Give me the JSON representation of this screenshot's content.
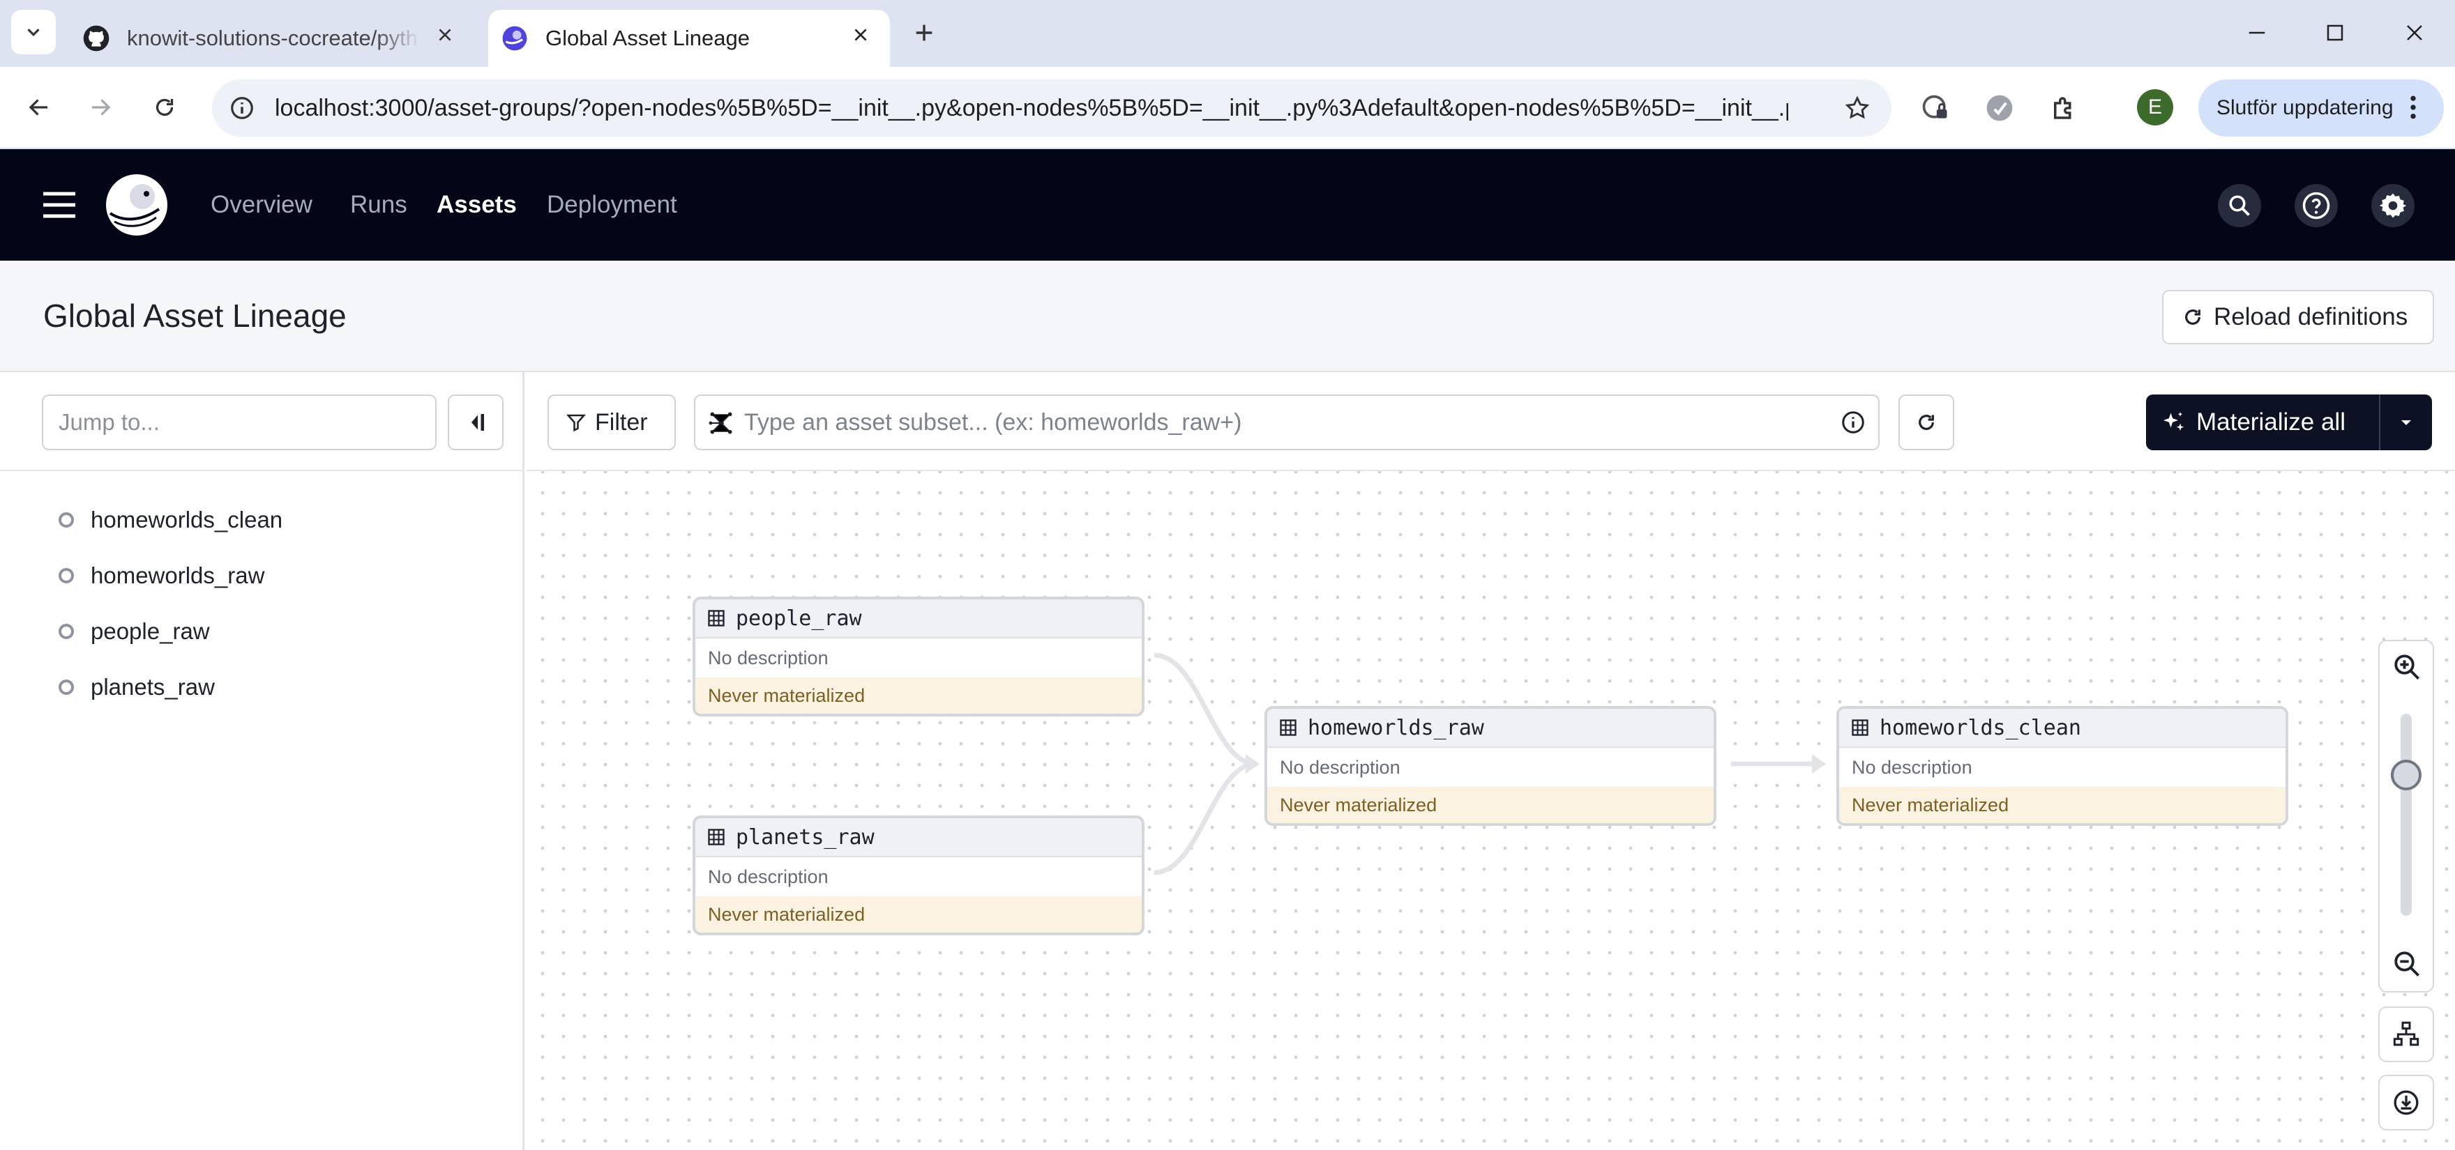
{
  "browser": {
    "tabs": [
      {
        "title": "knowit-solutions-cocreate/pyth",
        "favicon": "github-icon",
        "active": false
      },
      {
        "title": "Global Asset Lineage",
        "favicon": "dagster-icon",
        "active": true
      }
    ],
    "url": "localhost:3000/asset-groups/?open-nodes%5B%5D=__init__.py&open-nodes%5B%5D=__init__.py%3Adefault&open-nodes%5B%5D=__init__.p...",
    "profile_initial": "E",
    "update_label": "Slutför uppdatering"
  },
  "app": {
    "nav": [
      "Overview",
      "Runs",
      "Assets",
      "Deployment"
    ],
    "active_nav": "Assets",
    "page_title": "Global Asset Lineage",
    "reload_label": "Reload definitions"
  },
  "sidebar": {
    "jump_placeholder": "Jump to...",
    "assets": [
      "homeworlds_clean",
      "homeworlds_raw",
      "people_raw",
      "planets_raw"
    ]
  },
  "toolbar": {
    "filter_label": "Filter",
    "subset_placeholder": "Type an asset subset... (ex: homeworlds_raw+)",
    "materialize_label": "Materialize all"
  },
  "graph": {
    "nodes": [
      {
        "name": "people_raw",
        "description": "No description",
        "status": "Never materialized"
      },
      {
        "name": "planets_raw",
        "description": "No description",
        "status": "Never materialized"
      },
      {
        "name": "homeworlds_raw",
        "description": "No description",
        "status": "Never materialized"
      },
      {
        "name": "homeworlds_clean",
        "description": "No description",
        "status": "Never materialized"
      }
    ],
    "edges": [
      {
        "from": "people_raw",
        "to": "homeworlds_raw"
      },
      {
        "from": "planets_raw",
        "to": "homeworlds_raw"
      },
      {
        "from": "homeworlds_raw",
        "to": "homeworlds_clean"
      }
    ]
  },
  "colors": {
    "header_bg": "#030617",
    "never_materialized_bg": "#fbf2e2",
    "materialize_btn_bg": "#0c1224"
  }
}
